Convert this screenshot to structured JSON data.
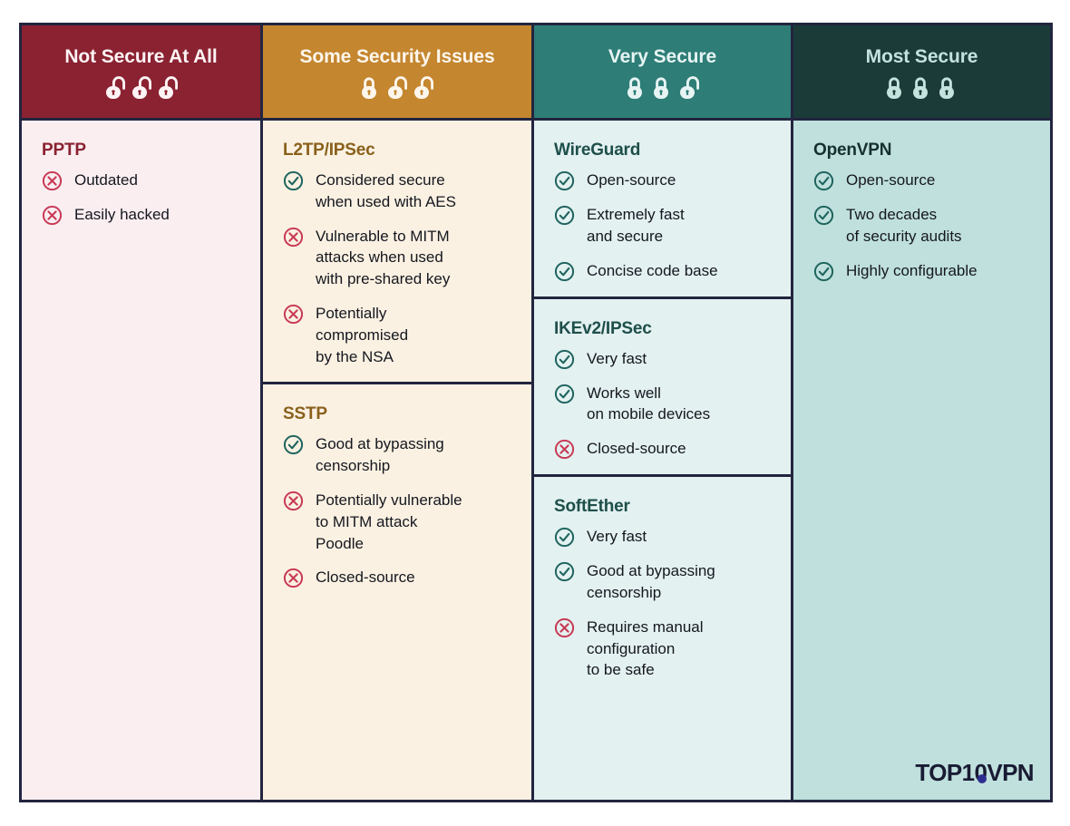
{
  "colors": {
    "border": "#22253f",
    "col1_header_bg": "#8a2231",
    "col1_body_bg": "#faeef1",
    "col2_header_bg": "#c4862f",
    "col2_body_bg": "#faf1e2",
    "col3_header_bg": "#2e7d77",
    "col3_body_bg": "#e3f1f1",
    "col4_header_bg": "#1b3b39",
    "col4_body_bg": "#bfe0dd",
    "check_icon": "#1f645e",
    "cross_icon": "#c83a55",
    "logo_text": "#191b33",
    "logo_dot": "#2c2f8f"
  },
  "columns": [
    {
      "header": {
        "title": "Not Secure At All",
        "locks": [
          "open",
          "open",
          "open"
        ]
      },
      "sections": [
        {
          "title": "PPTP",
          "items": [
            {
              "icon": "cross-icon",
              "text": "Outdated"
            },
            {
              "icon": "cross-icon",
              "text": "Easily hacked"
            }
          ]
        }
      ]
    },
    {
      "header": {
        "title": "Some Security Issues",
        "locks": [
          "closed",
          "open",
          "open"
        ]
      },
      "sections": [
        {
          "title": "L2TP/IPSec",
          "items": [
            {
              "icon": "check-icon",
              "text": "Considered secure\nwhen used with AES"
            },
            {
              "icon": "cross-icon",
              "text": "Vulnerable to MITM\nattacks when used\nwith pre-shared key"
            },
            {
              "icon": "cross-icon",
              "text": "Potentially\ncompromised\nby the NSA"
            }
          ]
        },
        {
          "title": "SSTP",
          "items": [
            {
              "icon": "check-icon",
              "text": "Good at bypassing\ncensorship"
            },
            {
              "icon": "cross-icon",
              "text": "Potentially vulnerable\nto MITM attack\nPoodle"
            },
            {
              "icon": "cross-icon",
              "text": "Closed-source"
            }
          ]
        }
      ]
    },
    {
      "header": {
        "title": "Very Secure",
        "locks": [
          "closed",
          "closed",
          "open"
        ]
      },
      "sections": [
        {
          "title": "WireGuard",
          "items": [
            {
              "icon": "check-icon",
              "text": "Open-source"
            },
            {
              "icon": "check-icon",
              "text": "Extremely fast\nand secure"
            },
            {
              "icon": "check-icon",
              "text": "Concise code base"
            }
          ]
        },
        {
          "title": "IKEv2/IPSec",
          "items": [
            {
              "icon": "check-icon",
              "text": "Very fast"
            },
            {
              "icon": "check-icon",
              "text": "Works well\non mobile devices"
            },
            {
              "icon": "cross-icon",
              "text": "Closed-source"
            }
          ]
        },
        {
          "title": "SoftEther",
          "items": [
            {
              "icon": "check-icon",
              "text": "Very fast"
            },
            {
              "icon": "check-icon",
              "text": "Good at bypassing\ncensorship"
            },
            {
              "icon": "cross-icon",
              "text": "Requires manual\nconfiguration\nto be safe"
            }
          ]
        }
      ]
    },
    {
      "header": {
        "title": "Most Secure",
        "locks": [
          "closed",
          "closed",
          "closed"
        ]
      },
      "sections": [
        {
          "title": "OpenVPN",
          "items": [
            {
              "icon": "check-icon",
              "text": "Open-source"
            },
            {
              "icon": "check-icon",
              "text": "Two decades\nof security audits"
            },
            {
              "icon": "check-icon",
              "text": "Highly configurable"
            }
          ]
        }
      ]
    }
  ],
  "logo": {
    "part1": "TOP1",
    "part2": "0",
    "part3": "VPN"
  }
}
